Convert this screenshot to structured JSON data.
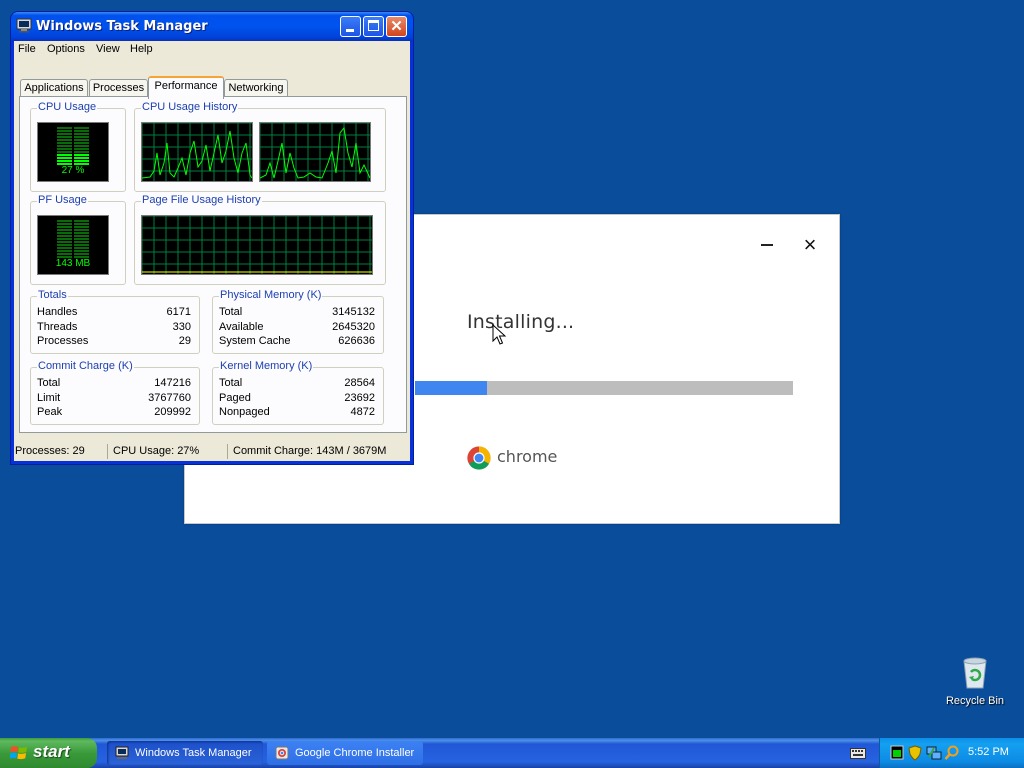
{
  "installer": {
    "status": "Installing...",
    "progress_percent": 19,
    "brand": "chrome",
    "minimize_label": "–",
    "close_label": "×"
  },
  "task_manager": {
    "title": "Windows Task Manager",
    "menu": [
      "File",
      "Options",
      "View",
      "Help"
    ],
    "tabs": [
      "Applications",
      "Processes",
      "Performance",
      "Networking"
    ],
    "active_tab": "Performance",
    "cpu_usage": {
      "title": "CPU Usage",
      "value": "27 %"
    },
    "cpu_history": {
      "title": "CPU Usage History"
    },
    "pf_usage": {
      "title": "PF Usage",
      "value": "143 MB"
    },
    "pf_history": {
      "title": "Page File Usage History"
    },
    "totals": {
      "title": "Totals",
      "rows": [
        {
          "label": "Handles",
          "value": "6171"
        },
        {
          "label": "Threads",
          "value": "330"
        },
        {
          "label": "Processes",
          "value": "29"
        }
      ]
    },
    "physical_memory": {
      "title": "Physical Memory (K)",
      "rows": [
        {
          "label": "Total",
          "value": "3145132"
        },
        {
          "label": "Available",
          "value": "2645320"
        },
        {
          "label": "System Cache",
          "value": "626636"
        }
      ]
    },
    "commit_charge": {
      "title": "Commit Charge (K)",
      "rows": [
        {
          "label": "Total",
          "value": "147216"
        },
        {
          "label": "Limit",
          "value": "3767760"
        },
        {
          "label": "Peak",
          "value": "209992"
        }
      ]
    },
    "kernel_memory": {
      "title": "Kernel Memory (K)",
      "rows": [
        {
          "label": "Total",
          "value": "28564"
        },
        {
          "label": "Paged",
          "value": "23692"
        },
        {
          "label": "Nonpaged",
          "value": "4872"
        }
      ]
    },
    "status_bar": {
      "processes": "Processes: 29",
      "cpu": "CPU Usage: 27%",
      "commit": "Commit Charge: 143M / 3679M"
    }
  },
  "desktop": {
    "recycle_bin": "Recycle Bin"
  },
  "taskbar": {
    "start": "start",
    "tasks": [
      {
        "label": "Windows Task Manager",
        "icon": "task-manager-icon"
      },
      {
        "label": "Google Chrome Installer",
        "icon": "chrome-installer-icon"
      }
    ],
    "clock": "5:52 PM"
  },
  "colors": {
    "desktop": "#0a4d9b",
    "progress_fill": "#3f86f0",
    "progress_track": "#bdbdbd",
    "scope_green": "#00ff00",
    "group_title": "#1c3fb0"
  }
}
